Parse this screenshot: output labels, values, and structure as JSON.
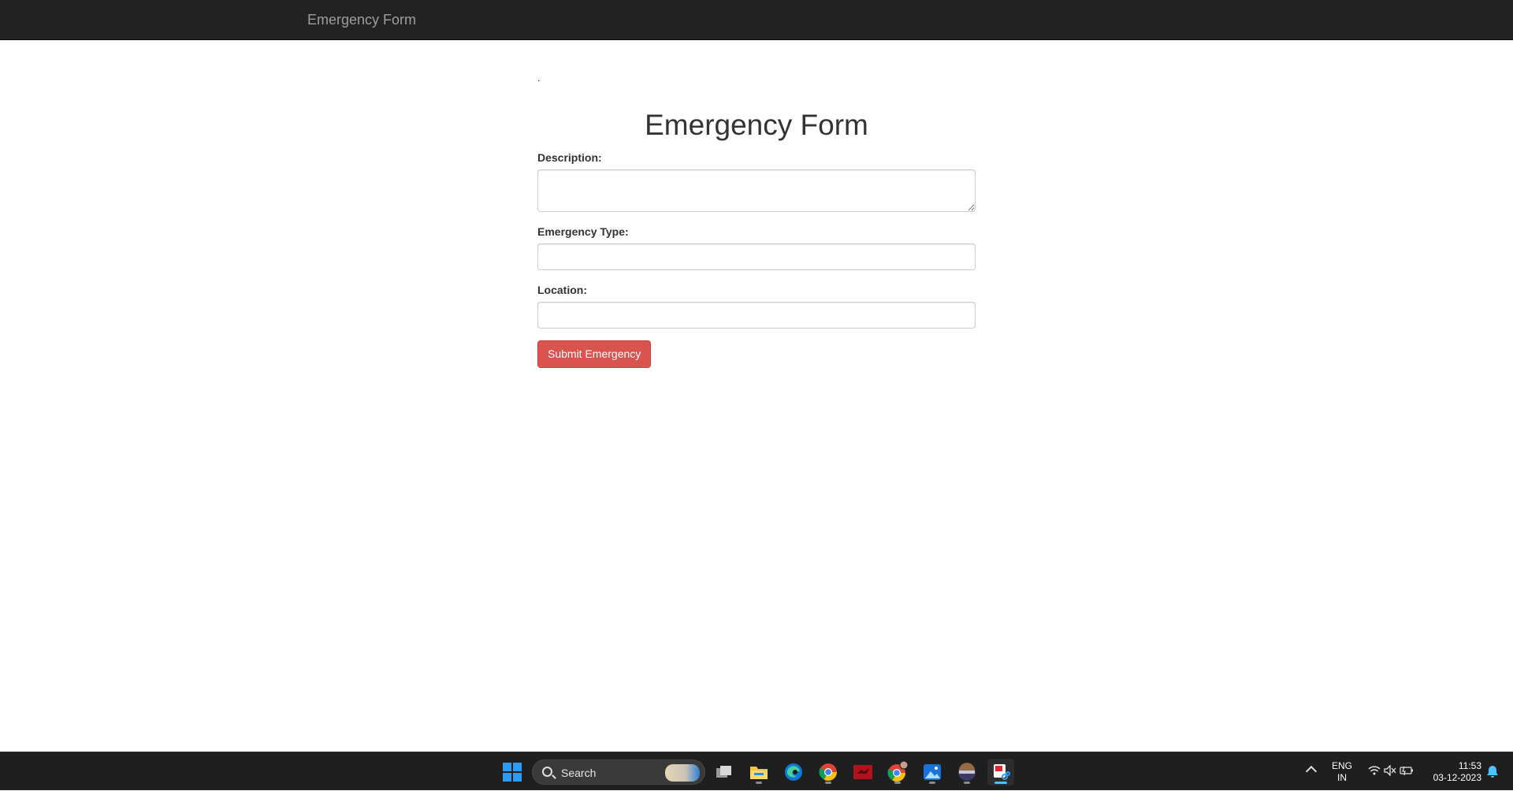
{
  "navbar": {
    "brand": "Emergency Form"
  },
  "page": {
    "dot": ".",
    "title": "Emergency Form"
  },
  "form": {
    "description_label": "Description:",
    "description_value": "",
    "type_label": "Emergency Type:",
    "type_value": "",
    "location_label": "Location:",
    "location_value": "",
    "submit_label": "Submit Emergency"
  },
  "colors": {
    "navbar_bg": "#222222",
    "submit_bg": "#d9534f",
    "taskbar_bg": "#1f1f1f"
  },
  "taskbar": {
    "search_placeholder": "Search",
    "apps": [
      {
        "name": "start-icon"
      },
      {
        "name": "task-view-icon"
      },
      {
        "name": "file-explorer-icon"
      },
      {
        "name": "edge-icon"
      },
      {
        "name": "chrome-icon"
      },
      {
        "name": "red-app-icon"
      },
      {
        "name": "chrome-profile-icon"
      },
      {
        "name": "photos-icon"
      },
      {
        "name": "media-app-icon"
      },
      {
        "name": "snipping-tool-icon"
      }
    ],
    "lang_top": "ENG",
    "lang_bottom": "IN",
    "time": "11:53",
    "date": "03-12-2023"
  }
}
